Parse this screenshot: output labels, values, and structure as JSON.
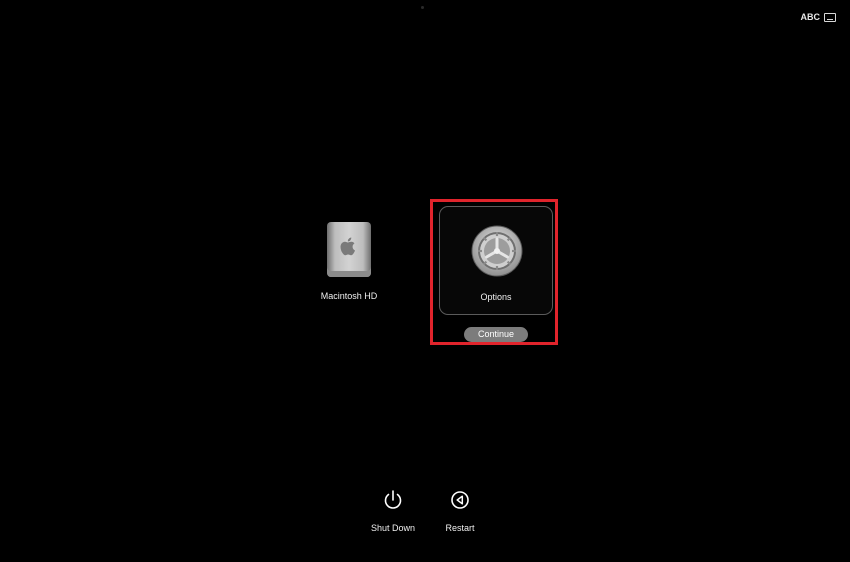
{
  "top_bar": {
    "input_source_label": "ABC",
    "input_source_icon": "keyboard-icon"
  },
  "volumes": [
    {
      "label": "Macintosh HD",
      "icon": "hard-disk-icon"
    }
  ],
  "options": {
    "label": "Options",
    "icon": "gear-icon",
    "continue_label": "Continue",
    "highlight_color": "#e0242c"
  },
  "bottom_actions": {
    "shut_down": {
      "label": "Shut Down",
      "icon": "power-icon"
    },
    "restart": {
      "label": "Restart",
      "icon": "restart-icon"
    }
  },
  "colors": {
    "background": "#000000",
    "button": "#7c7c7c"
  }
}
